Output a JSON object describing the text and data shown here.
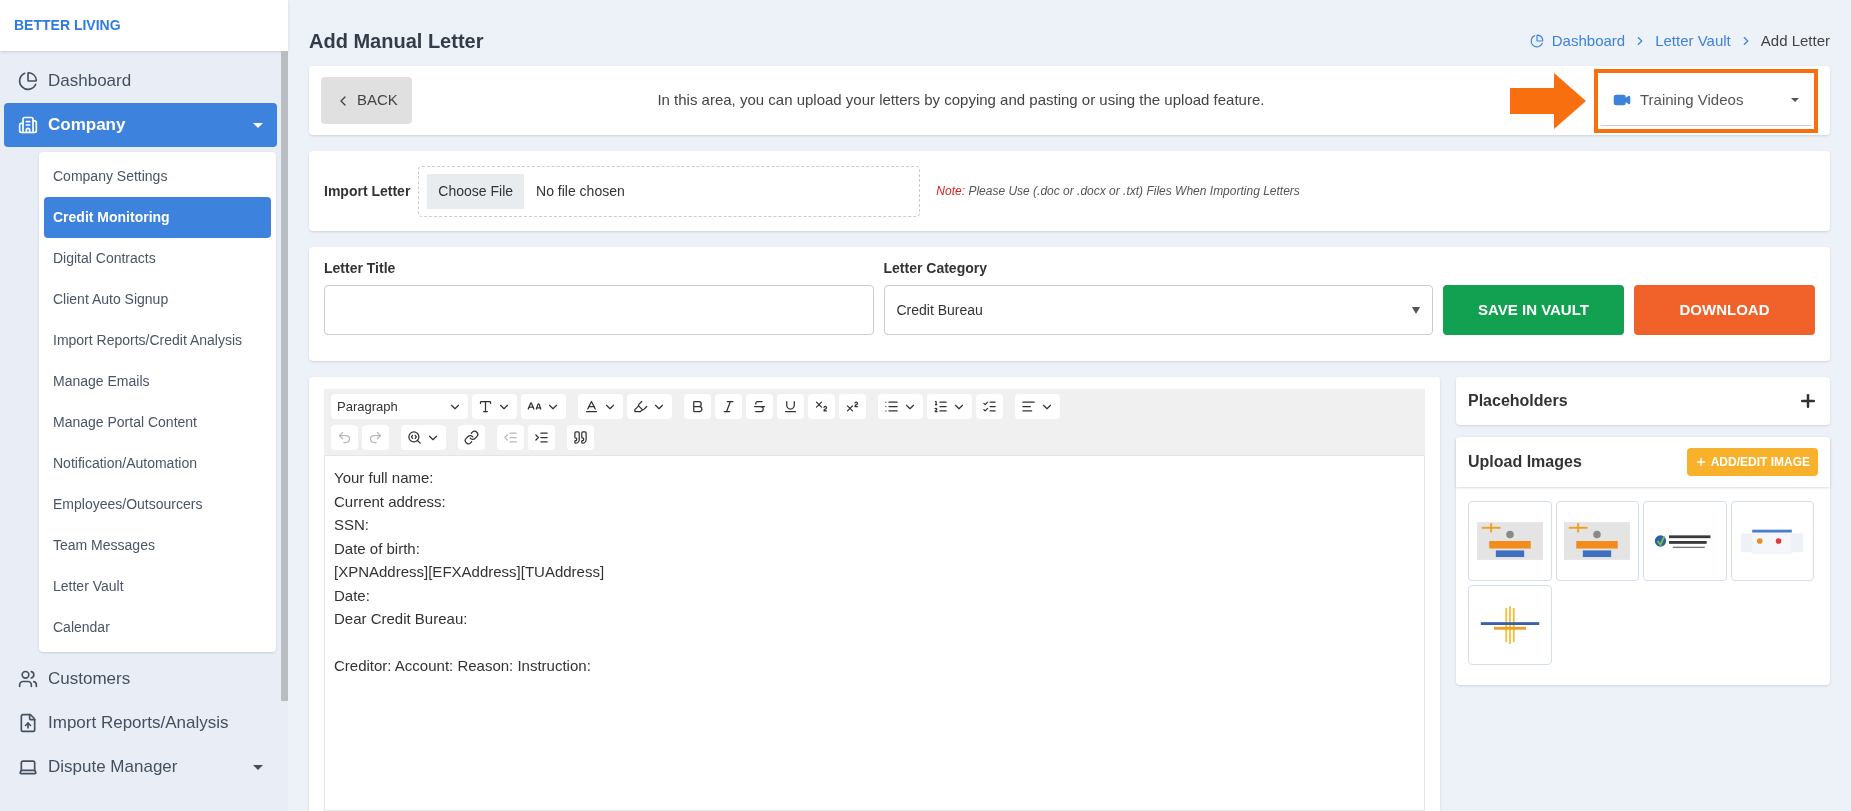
{
  "brand": "BETTER LIVING",
  "sidebar": {
    "items": [
      {
        "kind": "dashboard",
        "label": "Dashboard",
        "expanded": false,
        "has_caret": false
      },
      {
        "kind": "company",
        "label": "Company",
        "expanded": true,
        "has_caret": true,
        "children": [
          {
            "label": "Company Settings",
            "selected": false
          },
          {
            "label": "Credit Monitoring",
            "selected": true
          },
          {
            "label": "Digital Contracts",
            "selected": false
          },
          {
            "label": "Client Auto Signup",
            "selected": false
          },
          {
            "label": "Import Reports/Credit Analysis",
            "selected": false
          },
          {
            "label": "Manage Emails",
            "selected": false
          },
          {
            "label": "Manage Portal Content",
            "selected": false
          },
          {
            "label": "Notification/Automation",
            "selected": false
          },
          {
            "label": "Employees/Outsourcers",
            "selected": false
          },
          {
            "label": "Team Messages",
            "selected": false
          },
          {
            "label": "Letter Vault",
            "selected": false
          },
          {
            "label": "Calendar",
            "selected": false
          }
        ]
      },
      {
        "kind": "customers",
        "label": "Customers",
        "expanded": false,
        "has_caret": false
      },
      {
        "kind": "import",
        "label": "Import Reports/Analysis",
        "expanded": false,
        "has_caret": false
      },
      {
        "kind": "dispute",
        "label": "Dispute Manager",
        "expanded": false,
        "has_caret": true
      }
    ]
  },
  "page_title": "Add Manual Letter",
  "breadcrumb": [
    "Dashboard",
    "Letter Vault",
    "Add Letter"
  ],
  "top_bar": {
    "back": "BACK",
    "info": "In this area, you can upload your letters by copying and pasting or using the upload feature.",
    "training": "Training Videos",
    "highlighted": true
  },
  "import": {
    "label": "Import Letter",
    "button": "Choose File",
    "status": "No file chosen",
    "note_label": "Note:",
    "note": "Please Use (.doc or .docx or .txt) Files When Importing Letters"
  },
  "letter_title": {
    "label": "Letter Title"
  },
  "letter_category": {
    "label": "Letter Category",
    "value": "Credit Bureau"
  },
  "actions": [
    "SAVE IN VAULT",
    "DOWNLOAD"
  ],
  "editor": {
    "format": "Paragraph",
    "toolbar": [
      [
        {
          "kind": "font-size",
          "disabled": false
        },
        {
          "kind": "font-family",
          "disabled": false
        },
        {
          "kind": "font-color",
          "disabled": false
        },
        {
          "kind": "highlight",
          "disabled": false
        },
        {
          "kind": "bold",
          "disabled": false
        },
        {
          "kind": "italic",
          "disabled": false
        },
        {
          "kind": "strike",
          "disabled": false
        },
        {
          "kind": "underline",
          "disabled": false
        },
        {
          "kind": "subscript",
          "disabled": false
        },
        {
          "kind": "superscript",
          "disabled": false
        },
        {
          "kind": "bullets",
          "disabled": false
        },
        {
          "kind": "numbers",
          "disabled": false
        },
        {
          "kind": "todo",
          "disabled": false
        },
        {
          "kind": "align",
          "disabled": false
        }
      ],
      [
        {
          "kind": "undo",
          "disabled": true
        },
        {
          "kind": "redo",
          "disabled": true
        },
        {
          "kind": "find",
          "disabled": false
        },
        {
          "kind": "link",
          "disabled": false
        },
        {
          "kind": "outdent",
          "disabled": true
        },
        {
          "kind": "indent",
          "disabled": false
        },
        {
          "kind": "quote",
          "disabled": false
        }
      ]
    ],
    "paragraphs": [
      [
        "Your full name:",
        "Current address:",
        "SSN:",
        "Date of birth:",
        "[XPNAddress][EFXAddress][TUAddress]",
        "Date:",
        "Dear Credit Bureau:"
      ],
      [
        "Creditor: Account: Reason: Instruction:"
      ]
    ]
  },
  "placeholders": {
    "title": "Placeholders"
  },
  "upload_images": {
    "title": "Upload Images",
    "button": "ADD/EDIT IMAGE"
  }
}
